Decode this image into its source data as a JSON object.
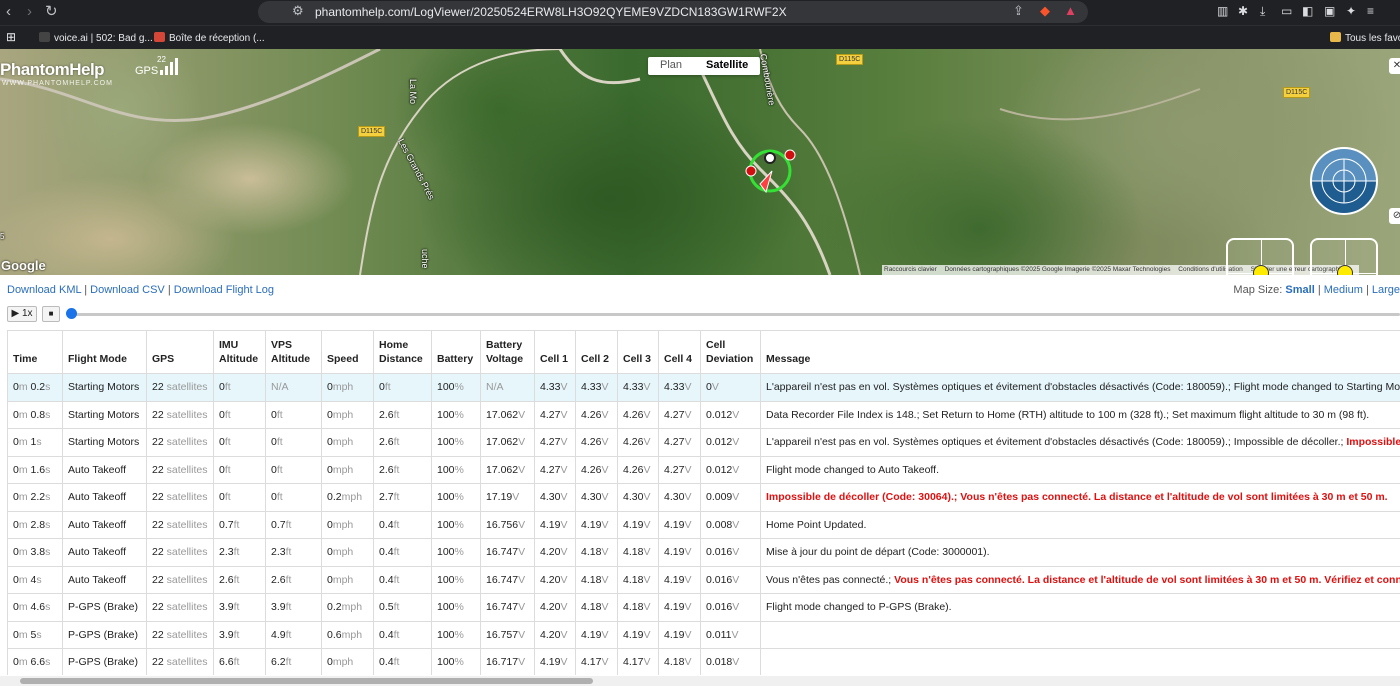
{
  "browser": {
    "url": "phantomhelp.com/LogViewer/20250524ERW8LH3O92QYEME9VZDCN183GW1RWF2X",
    "bookmarks": [
      {
        "label": "voice.ai | 502: Bad g...",
        "icon_color": "#444444"
      },
      {
        "label": "Boîte de réception (...",
        "icon_color": "#d44638"
      }
    ],
    "bookmarks_folder": "Tous les favoris"
  },
  "map": {
    "logo": "PhantomHelp",
    "logo_sub": "WWW.PHANTOMHELP.COM",
    "gps_label": "GPS",
    "gps_count": "22",
    "map_types": [
      "Plan",
      "Satellite"
    ],
    "map_type_selected": "Satellite",
    "place_labels": [
      "Les Grands Prés",
      "La Mo",
      "Combourière",
      "uche"
    ],
    "road_labels": [
      "D115C",
      "D115C",
      "D115C"
    ],
    "google_logo": "Google",
    "credits": [
      "Raccourcis clavier",
      "Données cartographiques ©2025 Google Imagerie ©2025 Maxar Technologies",
      "Conditions d'utilisation",
      "Signaler une erreur cartographique"
    ],
    "edge_label": "5"
  },
  "downloads": {
    "kml": "Download KML",
    "csv": "Download CSV",
    "flightlog": "Download Flight Log",
    "sep": "|"
  },
  "map_size": {
    "label": "Map Size:",
    "small": "Small",
    "medium": "Medium",
    "large": "Large",
    "selected": "Small"
  },
  "player": {
    "play_label": "▶ 1x",
    "stop_label": "■",
    "position": 0
  },
  "table": {
    "headers": [
      "Time",
      "Flight Mode",
      "GPS",
      "IMU Altitude",
      "VPS Altitude",
      "Speed",
      "Home Distance",
      "Battery",
      "Battery Voltage",
      "Cell 1",
      "Cell 2",
      "Cell 3",
      "Cell 4",
      "Cell Deviation",
      "Message"
    ],
    "rows": [
      {
        "time_m": "0",
        "time_s": "0.2",
        "mode": "Starting Motors",
        "gps": "22",
        "imu": "0",
        "vps": "N/A",
        "speed": "0",
        "home": "0",
        "battery": "100",
        "voltage": "N/A",
        "c1": "4.33",
        "c2": "4.33",
        "c3": "4.33",
        "c4": "4.33",
        "dev": "0",
        "msg": "L'appareil n'est pas en vol. Systèmes optiques et évitement d'obstacles désactivés (Code: 180059).; Flight mode changed to Starting Motors.",
        "msg_err": "",
        "msg_tail": "",
        "highlight": true
      },
      {
        "time_m": "0",
        "time_s": "0.8",
        "mode": "Starting Motors",
        "gps": "22",
        "imu": "0",
        "vps": "0",
        "speed": "0",
        "home": "2.6",
        "battery": "100",
        "voltage": "17.062",
        "c1": "4.27",
        "c2": "4.26",
        "c3": "4.26",
        "c4": "4.27",
        "dev": "0.012",
        "msg": "Data Recorder File Index is 148.; Set Return to Home (RTH) altitude to 100 m (328 ft).; Set maximum flight altitude to 30 m (98 ft).",
        "msg_err": "",
        "msg_tail": "",
        "highlight": false
      },
      {
        "time_m": "0",
        "time_s": "1",
        "mode": "Starting Motors",
        "gps": "22",
        "imu": "0",
        "vps": "0",
        "speed": "0",
        "home": "2.6",
        "battery": "100",
        "voltage": "17.062",
        "c1": "4.27",
        "c2": "4.26",
        "c3": "4.26",
        "c4": "4.27",
        "dev": "0.012",
        "msg": "L'appareil n'est pas en vol. Systèmes optiques et évitement d'obstacles désactivés (Code: 180059).; Impossible de décoller.; ",
        "msg_err": "Impossible de décoller",
        "msg_tail": "",
        "highlight": false
      },
      {
        "time_m": "0",
        "time_s": "1.6",
        "mode": "Auto Takeoff",
        "gps": "22",
        "imu": "0",
        "vps": "0",
        "speed": "0",
        "home": "2.6",
        "battery": "100",
        "voltage": "17.062",
        "c1": "4.27",
        "c2": "4.26",
        "c3": "4.26",
        "c4": "4.27",
        "dev": "0.012",
        "msg": "Flight mode changed to Auto Takeoff.",
        "msg_err": "",
        "msg_tail": "",
        "highlight": false
      },
      {
        "time_m": "0",
        "time_s": "2.2",
        "mode": "Auto Takeoff",
        "gps": "22",
        "imu": "0",
        "vps": "0",
        "speed": "0.2",
        "home": "2.7",
        "battery": "100",
        "voltage": "17.19",
        "c1": "4.30",
        "c2": "4.30",
        "c3": "4.30",
        "c4": "4.30",
        "dev": "0.009",
        "msg": "",
        "msg_err": "Impossible de décoller (Code: 30064).; Vous n'êtes pas connecté. La distance et l'altitude de vol sont limitées à 30 m et 50 m.",
        "msg_tail": "",
        "highlight": false
      },
      {
        "time_m": "0",
        "time_s": "2.8",
        "mode": "Auto Takeoff",
        "gps": "22",
        "imu": "0.7",
        "vps": "0.7",
        "speed": "0",
        "home": "0.4",
        "battery": "100",
        "voltage": "16.756",
        "c1": "4.19",
        "c2": "4.19",
        "c3": "4.19",
        "c4": "4.19",
        "dev": "0.008",
        "msg": "Home Point Updated.",
        "msg_err": "",
        "msg_tail": "",
        "highlight": false
      },
      {
        "time_m": "0",
        "time_s": "3.8",
        "mode": "Auto Takeoff",
        "gps": "22",
        "imu": "2.3",
        "vps": "2.3",
        "speed": "0",
        "home": "0.4",
        "battery": "100",
        "voltage": "16.747",
        "c1": "4.20",
        "c2": "4.18",
        "c3": "4.18",
        "c4": "4.19",
        "dev": "0.016",
        "msg": "Mise à jour du point de départ (Code: 3000001).",
        "msg_err": "",
        "msg_tail": "",
        "highlight": false
      },
      {
        "time_m": "0",
        "time_s": "4",
        "mode": "Auto Takeoff",
        "gps": "22",
        "imu": "2.6",
        "vps": "2.6",
        "speed": "0",
        "home": "0.4",
        "battery": "100",
        "voltage": "16.747",
        "c1": "4.20",
        "c2": "4.18",
        "c3": "4.18",
        "c4": "4.19",
        "dev": "0.016",
        "msg": "Vous n'êtes pas connecté.; ",
        "msg_err": "Vous n'êtes pas connecté. La distance et l'altitude de vol sont limitées à 30 m et 50 m. Vérifiez et connectez-vous.",
        "msg_tail": "",
        "highlight": false
      },
      {
        "time_m": "0",
        "time_s": "4.6",
        "mode": "P-GPS (Brake)",
        "gps": "22",
        "imu": "3.9",
        "vps": "3.9",
        "speed": "0.2",
        "home": "0.5",
        "battery": "100",
        "voltage": "16.747",
        "c1": "4.20",
        "c2": "4.18",
        "c3": "4.18",
        "c4": "4.19",
        "dev": "0.016",
        "msg": "Flight mode changed to P-GPS (Brake).",
        "msg_err": "",
        "msg_tail": "",
        "highlight": false
      },
      {
        "time_m": "0",
        "time_s": "5",
        "mode": "P-GPS (Brake)",
        "gps": "22",
        "imu": "3.9",
        "vps": "4.9",
        "speed": "0.6",
        "home": "0.4",
        "battery": "100",
        "voltage": "16.757",
        "c1": "4.20",
        "c2": "4.19",
        "c3": "4.19",
        "c4": "4.19",
        "dev": "0.011",
        "msg": "",
        "msg_err": "",
        "msg_tail": "",
        "highlight": false
      },
      {
        "time_m": "0",
        "time_s": "6.6",
        "mode": "P-GPS (Brake)",
        "gps": "22",
        "imu": "6.6",
        "vps": "6.2",
        "speed": "0",
        "home": "0.4",
        "battery": "100",
        "voltage": "16.717",
        "c1": "4.19",
        "c2": "4.17",
        "c3": "4.17",
        "c4": "4.18",
        "dev": "0.018",
        "msg": "",
        "msg_err": "",
        "msg_tail": "",
        "highlight": false
      }
    ],
    "units": {
      "m": "m",
      "s": "s",
      "sat": "satellites",
      "ft": "ft",
      "mph": "mph",
      "pct": "%",
      "v": "V"
    }
  }
}
